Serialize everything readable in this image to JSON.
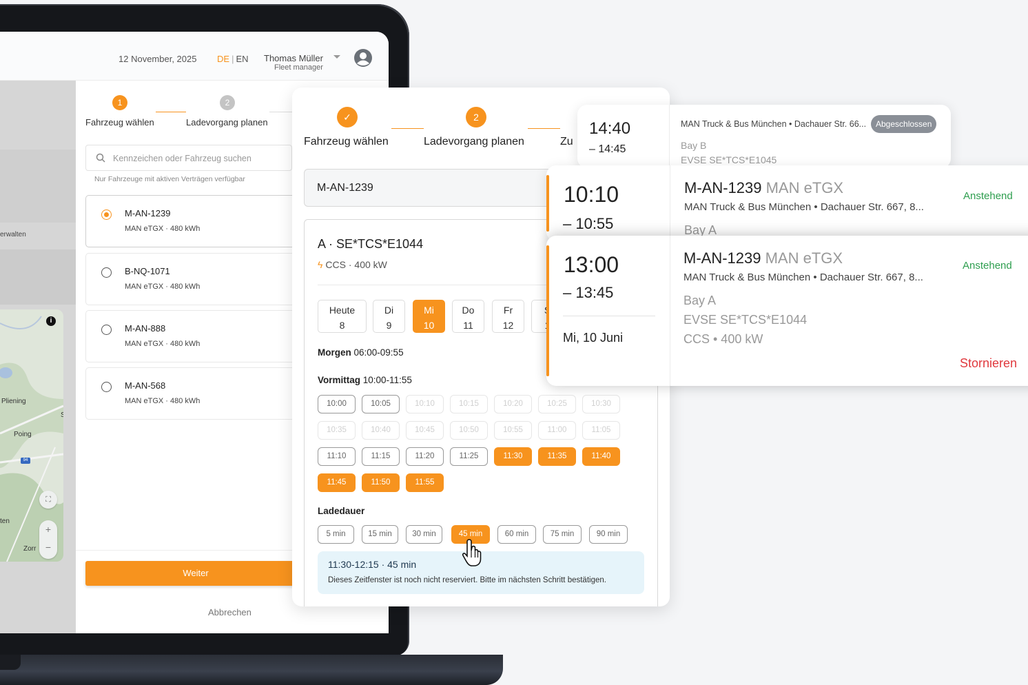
{
  "header": {
    "date": "12 November, 2025",
    "lang_active": "DE",
    "lang_sep": "|",
    "lang_other": "EN",
    "user_name": "Thomas Müller",
    "user_role": "Fleet manager"
  },
  "sidebar": {
    "partial_label": "erwalten"
  },
  "map": {
    "cities": [
      "Pliening",
      "Poing",
      "ten",
      "Zorr"
    ],
    "edge_letter": "S",
    "highway": "94"
  },
  "wizard_left": {
    "steps": [
      {
        "number": "1",
        "label": "Fahrzeug wählen"
      },
      {
        "number": "2",
        "label": "Ladevorgang planen"
      }
    ],
    "search_placeholder": "Kennzeichen oder Fahrzeug suchen",
    "hint": "Nur Fahrzeuge mit aktiven Verträgen verfügbar",
    "vehicles": [
      {
        "plate": "M-AN-1239",
        "spec": "MAN eTGX · 480 kWh",
        "selected": true
      },
      {
        "plate": "B-NQ-1071",
        "spec": "MAN eTGX · 480 kWh",
        "selected": false
      },
      {
        "plate": "M-AN-888",
        "spec": "MAN eTGX · 480 kWh",
        "selected": false
      },
      {
        "plate": "M-AN-568",
        "spec": "MAN eTGX · 480 kWh",
        "selected": false
      }
    ],
    "next_label": "Weiter",
    "cancel_label": "Abbrechen"
  },
  "booking": {
    "steps": [
      {
        "label": "Fahrzeug wählen",
        "mark": "✓"
      },
      {
        "label": "Ladevorgang planen",
        "mark": "2"
      },
      {
        "label": "Zu"
      }
    ],
    "plate": "M-AN-1239",
    "charger_title": "A · SE*TCS*E1044",
    "charger_spec": "CCS · 400 kW",
    "days": [
      {
        "name": "Heute",
        "num": "8"
      },
      {
        "name": "Di",
        "num": "9"
      },
      {
        "name": "Mi",
        "num": "10",
        "selected": true
      },
      {
        "name": "Do",
        "num": "11"
      },
      {
        "name": "Fr",
        "num": "12"
      },
      {
        "name": "S",
        "num": "1"
      }
    ],
    "morning_label": "Morgen",
    "morning_range": "06:00-09:55",
    "forenoon_label": "Vormittag",
    "forenoon_range": "10:00-11:55",
    "slots": [
      {
        "t": "10:00",
        "s": "on"
      },
      {
        "t": "10:05",
        "s": "on"
      },
      {
        "t": "10:10",
        "s": "dis"
      },
      {
        "t": "10:15",
        "s": "dis"
      },
      {
        "t": "10:20",
        "s": "dis"
      },
      {
        "t": "10:25",
        "s": "dis"
      },
      {
        "t": "10:30",
        "s": "dis"
      },
      {
        "t": "10:35",
        "s": "dis"
      },
      {
        "t": "10:40",
        "s": "dis"
      },
      {
        "t": "10:45",
        "s": "dis"
      },
      {
        "t": "10:50",
        "s": "dis"
      },
      {
        "t": "10:55",
        "s": "dis"
      },
      {
        "t": "11:00",
        "s": "dis"
      },
      {
        "t": "11:05",
        "s": "dis"
      },
      {
        "t": "11:10",
        "s": "on"
      },
      {
        "t": "11:15",
        "s": "on"
      },
      {
        "t": "11:20",
        "s": "on"
      },
      {
        "t": "11:25",
        "s": "on"
      },
      {
        "t": "11:30",
        "s": "sel"
      },
      {
        "t": "11:35",
        "s": "sel"
      },
      {
        "t": "11:40",
        "s": "sel"
      },
      {
        "t": "11:45",
        "s": "sel"
      },
      {
        "t": "11:50",
        "s": "sel"
      },
      {
        "t": "11:55",
        "s": "sel"
      }
    ],
    "duration_label": "Ladedauer",
    "durations": [
      {
        "t": "5 min"
      },
      {
        "t": "15 min"
      },
      {
        "t": "30 min"
      },
      {
        "t": "45 min",
        "sel": true
      },
      {
        "t": "60 min"
      },
      {
        "t": "75 min"
      },
      {
        "t": "90 min"
      }
    ],
    "summary_title": "11:30-12:15 · 45 min",
    "summary_note": "Dieses Zeitfenster ist noch nicht reserviert. Bitte im nächsten Schritt bestätigen."
  },
  "appointments": [
    {
      "start": "14:40",
      "end": "– 14:45",
      "location": "MAN Truck & Bus München • Dachauer Str. 66...",
      "status": "Abgeschlossen",
      "bay": "Bay B",
      "evse": "EVSE SE*TCS*E1045"
    },
    {
      "start": "10:10",
      "end": "– 10:55",
      "plate": "M-AN-1239",
      "model": "MAN eTGX",
      "location": "MAN Truck & Bus München • Dachauer Str. 667, 8...",
      "status": "Anstehend",
      "bay": "Bay A"
    },
    {
      "start": "13:00",
      "end": "– 13:45",
      "date": "Mi, 10 Juni",
      "plate": "M-AN-1239",
      "model": "MAN eTGX",
      "location": "MAN Truck & Bus München • Dachauer Str. 667, 8...",
      "status": "Anstehend",
      "bay": "Bay A",
      "evse": "EVSE SE*TCS*E1044",
      "connector": "CCS • 400 kW",
      "action": "Stornieren"
    }
  ],
  "colors": {
    "accent": "#f7931e",
    "success": "#2e9e4f",
    "danger": "#e0393e",
    "info_bg": "#e6f4fa"
  }
}
